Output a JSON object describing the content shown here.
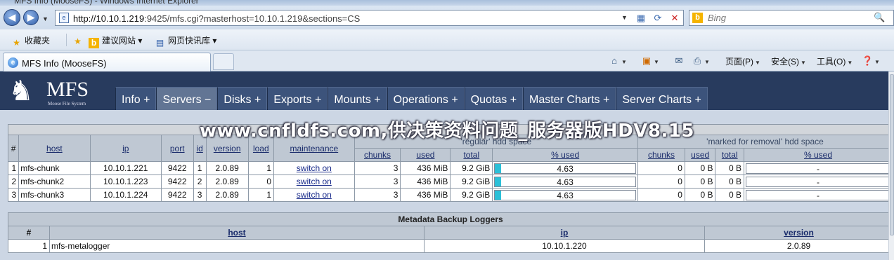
{
  "browser": {
    "title_text": "MFS Info (MooseFS) - Windows Internet Explorer",
    "address_url_host": "http://10.10.1.219",
    "address_url_rest": ":9425/mfs.cgi?masterhost=10.10.1.219&sections=CS",
    "search_placeholder": "Bing",
    "favorites": [
      "收藏夹",
      "建议网站",
      "网页快讯库"
    ],
    "tab_title": "MFS Info (MooseFS)",
    "commands": [
      "页面(P)",
      "安全(S)",
      "工具(O)"
    ]
  },
  "mfs": {
    "logo_text": "MFS",
    "logo_sub": "Moose File System",
    "nav": [
      "Info +",
      "Servers −",
      "Disks +",
      "Exports +",
      "Mounts +",
      "Operations +",
      "Quotas +",
      "Master Charts +",
      "Server Charts +"
    ],
    "servers_table": {
      "group_regular": "'regular' hdd space",
      "group_removal": "'marked for removal' hdd space",
      "headers": [
        "#",
        "host",
        "ip",
        "port",
        "id",
        "version",
        "load",
        "maintenance",
        "chunks",
        "used",
        "total",
        "% used",
        "chunks",
        "used",
        "total",
        "% used"
      ],
      "rows": [
        {
          "n": "1",
          "host": "mfs-chunk",
          "ip": "10.10.1.221",
          "port": "9422",
          "id": "1",
          "version": "2.0.89",
          "load": "1",
          "maint": "switch on",
          "chunks": "3",
          "used": "436 MiB",
          "total": "9.2 GiB",
          "pct": "4.63",
          "pct_value": 4.63,
          "rchunks": "0",
          "rused": "0 B",
          "rtotal": "0 B",
          "rpct": "-"
        },
        {
          "n": "2",
          "host": "mfs-chunk2",
          "ip": "10.10.1.223",
          "port": "9422",
          "id": "2",
          "version": "2.0.89",
          "load": "0",
          "maint": "switch on",
          "chunks": "3",
          "used": "436 MiB",
          "total": "9.2 GiB",
          "pct": "4.63",
          "pct_value": 4.63,
          "rchunks": "0",
          "rused": "0 B",
          "rtotal": "0 B",
          "rpct": "-"
        },
        {
          "n": "3",
          "host": "mfs-chunk3",
          "ip": "10.10.1.224",
          "port": "9422",
          "id": "3",
          "version": "2.0.89",
          "load": "1",
          "maint": "switch on",
          "chunks": "3",
          "used": "436 MiB",
          "total": "9.2 GiB",
          "pct": "4.63",
          "pct_value": 4.63,
          "rchunks": "0",
          "rused": "0 B",
          "rtotal": "0 B",
          "rpct": "-"
        }
      ]
    },
    "metalogger_table": {
      "title": "Metadata Backup Loggers",
      "headers": [
        "#",
        "host",
        "ip",
        "version"
      ],
      "rows": [
        {
          "n": "1",
          "host": "mfs-metalogger",
          "ip": "10.10.1.220",
          "version": "2.0.89"
        }
      ]
    }
  },
  "watermark": "www.cnfldfs.com,供决策资料问题_服务器版HDV8.15",
  "colors": {
    "header_bg": "#283b5e",
    "nav_bg": "#3c537b",
    "bar_fill": "#2bc0d8"
  }
}
